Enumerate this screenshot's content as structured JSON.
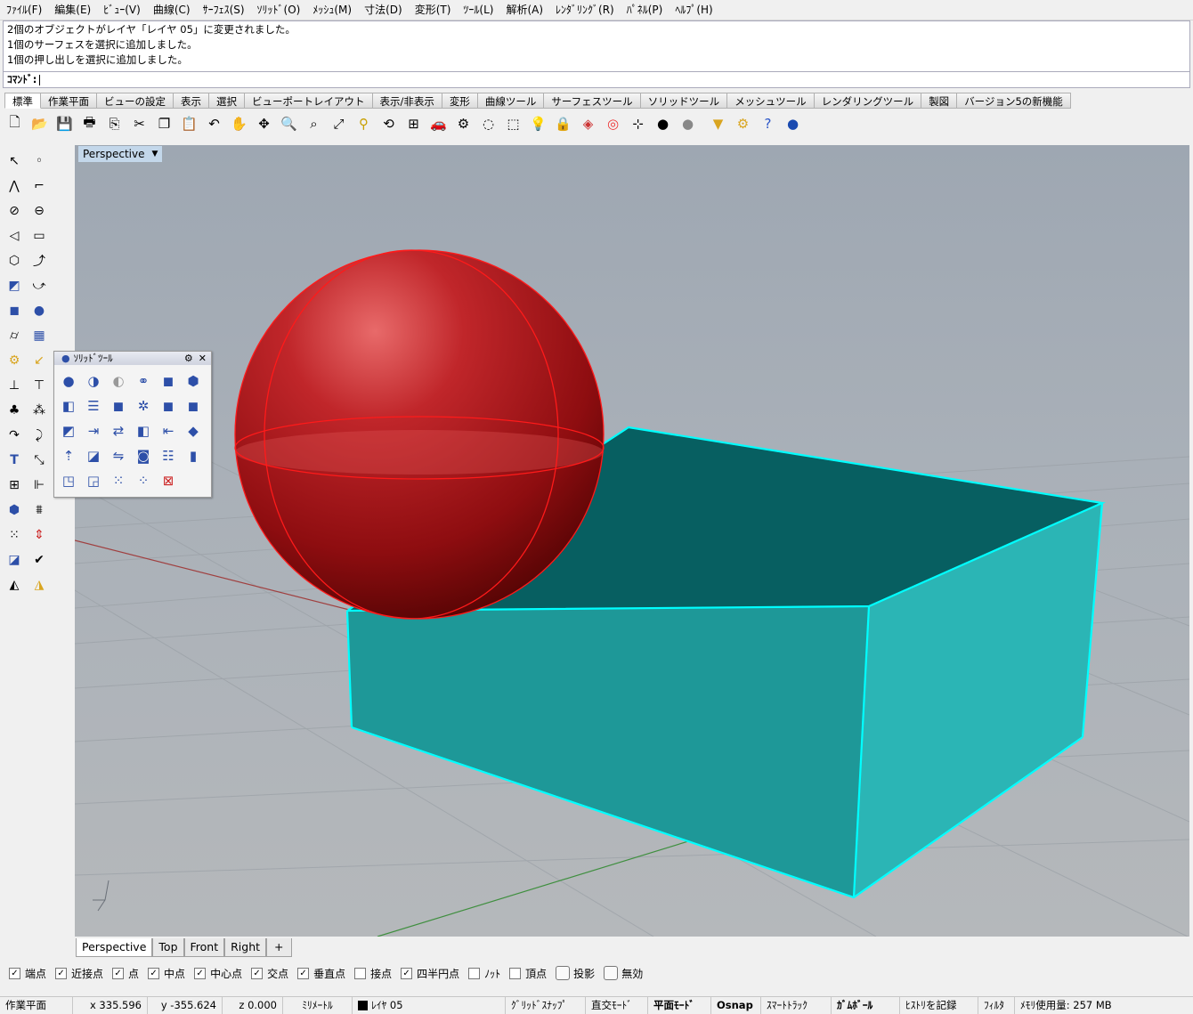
{
  "menu": [
    "ﾌｧｲﾙ(F)",
    "編集(E)",
    "ﾋﾞｭｰ(V)",
    "曲線(C)",
    "ｻｰﾌｪｽ(S)",
    "ｿﾘｯﾄﾞ(O)",
    "ﾒｯｼｭ(M)",
    "寸法(D)",
    "変形(T)",
    "ﾂｰﾙ(L)",
    "解析(A)",
    "ﾚﾝﾀﾞﾘﾝｸﾞ(R)",
    "ﾊﾟﾈﾙ(P)",
    "ﾍﾙﾌﾟ(H)"
  ],
  "history": [
    "2個のオブジェクトがレイヤ「レイヤ 05」に変更されました。",
    "1個のサーフェスを選択に追加しました。",
    "1個の押し出しを選択に追加しました。"
  ],
  "command_label": "ｺﾏﾝﾄﾞ:",
  "tabs": [
    "標準",
    "作業平面",
    "ビューの設定",
    "表示",
    "選択",
    "ビューポートレイアウト",
    "表示/非表示",
    "変形",
    "曲線ツール",
    "サーフェスツール",
    "ソリッドツール",
    "メッシュツール",
    "レンダリングツール",
    "製図",
    "バージョン5の新機能"
  ],
  "toolbar_icons": [
    "new-icon",
    "open-icon",
    "save-icon",
    "print-icon",
    "import-icon",
    "cut-icon",
    "copy-icon",
    "paste-icon",
    "undo-icon",
    "pan-icon",
    "rotate-view-icon",
    "zoom-window-icon",
    "zoom-dynamic-icon",
    "zoom-extents-icon",
    "zoom-selected-icon",
    "rotate-icon",
    "four-views-icon",
    "car-icon",
    "object-properties-icon",
    "select-icon",
    "snap-icon",
    "light-icon",
    "lock-icon",
    "layers-icon",
    "color-wheel-icon",
    "named-cplane-icon",
    "render-sphere-icon",
    "material-sphere-icon",
    "record-icon",
    "options-icon",
    "help-icon",
    "globe-icon"
  ],
  "viewport": {
    "title": "Perspective"
  },
  "solid_panel": {
    "title": "ｿﾘｯﾄﾞﾂｰﾙ"
  },
  "viewport_tabs": [
    "Perspective",
    "Top",
    "Front",
    "Right",
    "+"
  ],
  "osnap": [
    {
      "label": "端点",
      "checked": true
    },
    {
      "label": "近接点",
      "checked": true
    },
    {
      "label": "点",
      "checked": true
    },
    {
      "label": "中点",
      "checked": true
    },
    {
      "label": "中心点",
      "checked": true
    },
    {
      "label": "交点",
      "checked": true
    },
    {
      "label": "垂直点",
      "checked": true
    },
    {
      "label": "接点",
      "checked": false
    },
    {
      "label": "四半円点",
      "checked": true
    },
    {
      "label": "ﾉｯﾄ",
      "checked": false
    },
    {
      "label": "頂点",
      "checked": false
    }
  ],
  "osnap_toggles": [
    "投影",
    "無効"
  ],
  "status": {
    "cplane": "作業平面",
    "x": "x 335.596",
    "y": "y -355.624",
    "z": "z 0.000",
    "units": "ﾐﾘﾒｰﾄﾙ",
    "layer": "ﾚｲﾔ 05",
    "grid_snap": "ｸﾞﾘｯﾄﾞｽﾅｯﾌﾟ",
    "ortho": "直交ﾓｰﾄﾞ",
    "planar": "平面ﾓｰﾄﾞ",
    "osnap": "Osnap",
    "smarttrack": "ｽﾏｰﾄﾄﾗｯｸ",
    "gumball": "ｶﾞﾑﾎﾞｰﾙ",
    "history": "ﾋｽﾄﾘを記録",
    "filter": "ﾌｨﾙﾀ",
    "memory": "ﾒﾓﾘ使用量: 257 MB"
  },
  "colors": {
    "box": "#22a8a8",
    "box_edge": "#00ffff",
    "sphere": "#c0171c",
    "sphere_edge": "#ff0000",
    "viewport_bg": "#a9b0b8"
  }
}
